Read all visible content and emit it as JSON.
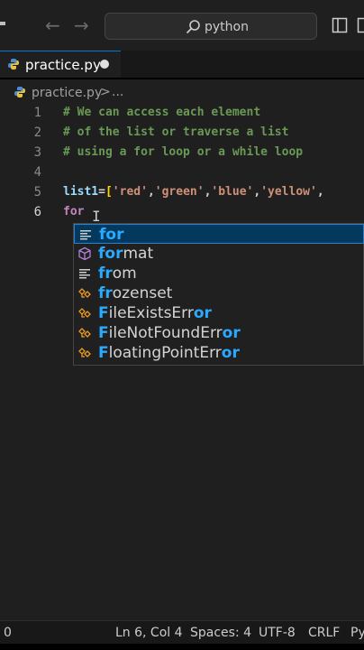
{
  "titlebar": {
    "back_icon": "arrow-left-icon",
    "forward_icon": "arrow-right-icon",
    "search_text": "python",
    "colors": {
      "bg": "#1f1f1f",
      "search_bg": "#2b2b2b"
    }
  },
  "tab": {
    "file_name": "practice.py",
    "dirty": true,
    "accent": "#0078d4"
  },
  "breadcrumb": {
    "file": "practice.py",
    "separator": ">",
    "more": "..."
  },
  "editor": {
    "lines": [
      {
        "number": "1",
        "text": "# We can access each element"
      },
      {
        "number": "2",
        "text": "# of the list or traverse a list"
      },
      {
        "number": "3",
        "text": "# using a for loop or a while loop"
      },
      {
        "number": "4",
        "text": ""
      },
      {
        "number": "5",
        "text": "list1=['red','green','blue','yellow',"
      },
      {
        "number": "6",
        "text": "for "
      }
    ],
    "line5": {
      "name": "list1",
      "eq": "=",
      "open": "[",
      "s1": "'red'",
      "s2": "'green'",
      "s3": "'blue'",
      "s4": "'yellow'",
      "comma": ","
    },
    "line6_keyword": "for",
    "cursor": "I",
    "colors": {
      "comment": "#6a9955",
      "keyword": "#c586c0",
      "string": "#ce9178",
      "identifier": "#9cdcfe"
    }
  },
  "suggestions": [
    {
      "kind": "snippet",
      "icon": "snippet-icon",
      "match": "for",
      "rest": ""
    },
    {
      "kind": "module",
      "icon": "cube-icon",
      "match": "for",
      "rest": "mat"
    },
    {
      "kind": "snippet",
      "icon": "snippet-icon",
      "match": "fr",
      "rest": "om"
    },
    {
      "kind": "class",
      "icon": "class-icon",
      "match": "fr",
      "rest": "ozenset"
    },
    {
      "kind": "class",
      "icon": "class-icon",
      "match": "F",
      "mid": "ileExistsErr",
      "match2": "or"
    },
    {
      "kind": "class",
      "icon": "class-icon",
      "match": "F",
      "mid": "ileNotFoundErr",
      "match2": "or"
    },
    {
      "kind": "class",
      "icon": "class-icon",
      "match": "F",
      "mid": "loatingPointErr",
      "match2": "or"
    }
  ],
  "statusbar": {
    "problems": "0",
    "position": "Ln 6, Col 4",
    "spaces": "Spaces: 4",
    "encoding": "UTF-8",
    "eol": "CRLF",
    "language": "Py"
  }
}
